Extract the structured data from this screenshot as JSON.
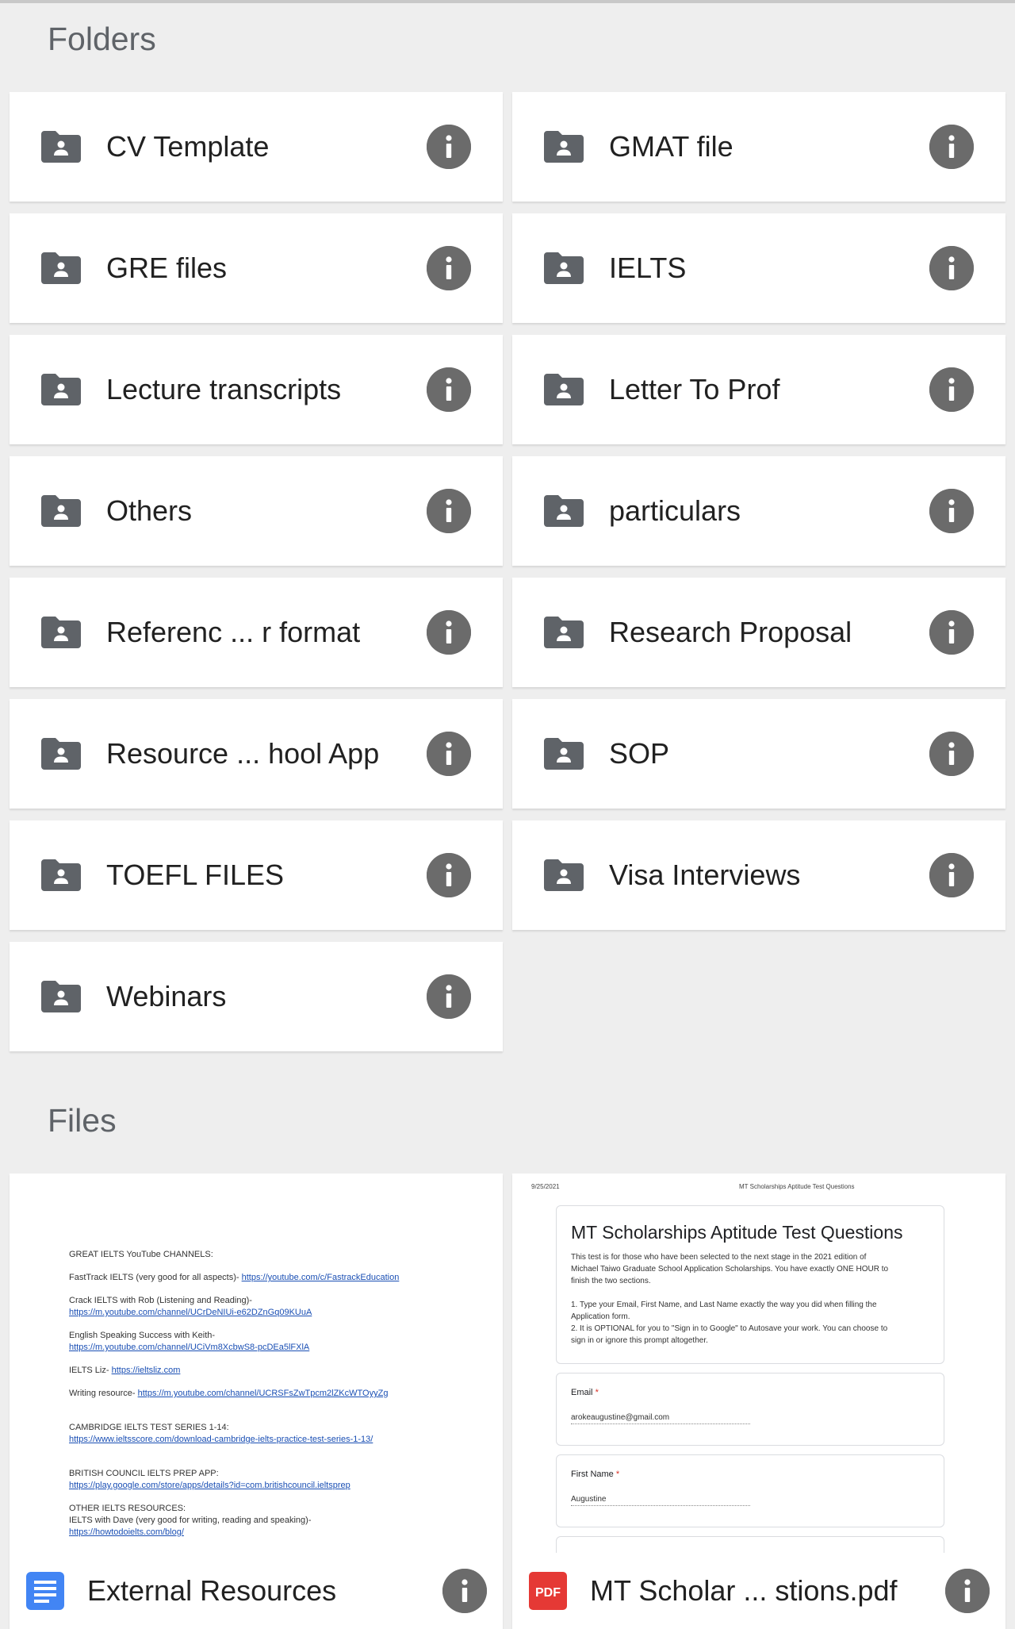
{
  "folders_section": {
    "title": "Folders",
    "items": [
      {
        "name": "CV Template"
      },
      {
        "name": "GMAT file"
      },
      {
        "name": "GRE files"
      },
      {
        "name": "IELTS"
      },
      {
        "name": "Lecture transcripts"
      },
      {
        "name": "Letter To Prof"
      },
      {
        "name": "Others"
      },
      {
        "name": "particulars"
      },
      {
        "name": "Referenc ... r format"
      },
      {
        "name": "Research Proposal"
      },
      {
        "name": "Resource ... hool App"
      },
      {
        "name": "SOP"
      },
      {
        "name": "TOEFL FILES"
      },
      {
        "name": "Visa Interviews"
      },
      {
        "name": "Webinars"
      }
    ],
    "icon": "shared-folder-icon",
    "info_icon": "info-icon"
  },
  "files_section": {
    "title": "Files",
    "items": [
      {
        "name": "External Resources",
        "type_icon": "google-docs-icon",
        "type_color": "#4285f4",
        "preview": {
          "lines": [
            {
              "text": "GREAT IELTS YouTube CHANNELS:"
            },
            {
              "gap": true
            },
            {
              "text": "FastTrack IELTS (very good for all aspects)- ",
              "link": "https://youtube.com/c/FastrackEducation"
            },
            {
              "gap": true
            },
            {
              "text": "Crack IELTS with Rob (Listening and Reading)-"
            },
            {
              "link": "https://m.youtube.com/channel/UCrDeNIUi-e62DZnGq09KUuA"
            },
            {
              "gap": true
            },
            {
              "text": "English Speaking Success with Keith-"
            },
            {
              "link": "https://m.youtube.com/channel/UCiVm8XcbwS8-pcDEa5lFXlA"
            },
            {
              "gap": true
            },
            {
              "text": "IELTS Liz- ",
              "link": "https://ieltsliz.com"
            },
            {
              "gap": true
            },
            {
              "text": "Writing resource- ",
              "link": "https://m.youtube.com/channel/UCRSFsZwTpcm2lZKcWTOyyZg"
            },
            {
              "gap": true
            },
            {
              "gap": true
            },
            {
              "text": "CAMBRIDGE IELTS TEST SERIES 1-14:"
            },
            {
              "link": "https://www.ieltsscore.com/download-cambridge-ielts-practice-test-series-1-13/"
            },
            {
              "gap": true
            },
            {
              "gap": true
            },
            {
              "text": "BRITISH COUNCIL IELTS PREP APP:"
            },
            {
              "link": "https://play.google.com/store/apps/details?id=com.britishcouncil.ieltsprep"
            },
            {
              "gap": true
            },
            {
              "text": "OTHER IELTS RESOURCES:"
            },
            {
              "text": "IELTS with Dave (very good for writing, reading and speaking)-"
            },
            {
              "link": "https://howtodoielts.com/blog/"
            }
          ]
        }
      },
      {
        "name": "MT Scholar ... stions.pdf",
        "type_icon": "pdf-icon",
        "type_label": "PDF",
        "type_color": "#e53935",
        "preview": {
          "date": "9/25/2021",
          "header_title": "MT Scholarships Aptitude Test Questions",
          "title": "MT Scholarships Aptitude Test Questions",
          "description": [
            "This test is for those who have been selected to the next stage in the 2021 edition of",
            "Michael Taiwo Graduate School Application Scholarships. You have exactly ONE HOUR to",
            "finish the two sections.",
            "",
            "1. Type your Email, First Name, and Last Name exactly the way you did when filling the",
            "Application form.",
            "2. It is OPTIONAL for you to \"Sign in to Google\" to Autosave your work. You can choose to",
            "sign in or ignore this prompt altogether."
          ],
          "fields": [
            {
              "label": "Email",
              "required_mark": "*",
              "value": "arokeaugustine@gmail.com"
            },
            {
              "label": "First Name",
              "required_mark": "*",
              "value": "Augustine"
            }
          ]
        }
      }
    ]
  },
  "colors": {
    "background": "#eeeeee",
    "card": "#ffffff",
    "icon_gray": "#5f6368",
    "info_gray": "#6b6b6b",
    "link_blue": "#1a4fb4"
  }
}
